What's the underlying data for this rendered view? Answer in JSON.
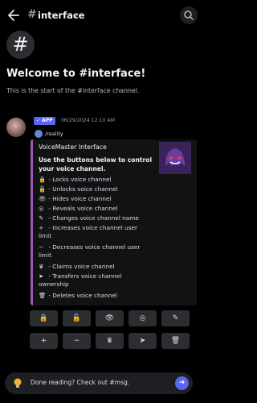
{
  "topbar": {
    "hash": "#",
    "channel_name": "interface",
    "chevron": "›"
  },
  "intro": {
    "hash": "#",
    "welcome": "Welcome to #interface!",
    "start_text": "This is the start of the #interface channel."
  },
  "message": {
    "badge": "✓ APP",
    "timestamp": "06/29/2024 12:10 AM",
    "reply_name": "/reality"
  },
  "embed": {
    "title": "VoiceMaster Interface",
    "heading": "Use the buttons below to control your voice channel.",
    "accent_color": "#9b59b6",
    "features": [
      {
        "icon": "lock-icon",
        "glyph": "🔒",
        "text": "- Locks voice channel",
        "cont": ""
      },
      {
        "icon": "unlock-icon",
        "glyph": "🔓",
        "text": "- Unlocks voice channel",
        "cont": ""
      },
      {
        "icon": "eye-icon",
        "glyph": "👁",
        "text": "- Hides voice channel",
        "cont": ""
      },
      {
        "icon": "eye-off-icon",
        "glyph": "◎",
        "text": "- Reveals voice channel",
        "cont": ""
      },
      {
        "icon": "pencil-icon",
        "glyph": "✎",
        "text": "- Changes voice channel name",
        "cont": ""
      },
      {
        "icon": "user-plus-icon",
        "glyph": "+",
        "text": "- Increases voice channel user",
        "cont": "limit"
      },
      {
        "icon": "user-minus-icon",
        "glyph": "−",
        "text": "- Decreases voice channel user",
        "cont": "limit"
      },
      {
        "icon": "crown-icon",
        "glyph": "♛",
        "text": "- Claims voice channel",
        "cont": ""
      },
      {
        "icon": "send-icon",
        "glyph": "➤",
        "text": "- Transfers voice channel",
        "cont": "ownership"
      },
      {
        "icon": "trash-icon",
        "glyph": "🗑",
        "text": "- Deletes voice channel",
        "cont": ""
      }
    ]
  },
  "buttons": [
    {
      "name": "lock",
      "glyph": "🔒"
    },
    {
      "name": "unlock",
      "glyph": "🔓"
    },
    {
      "name": "hide",
      "glyph": "👁"
    },
    {
      "name": "reveal",
      "glyph": "◎"
    },
    {
      "name": "rename",
      "glyph": "✎"
    },
    {
      "name": "increase",
      "glyph": "+"
    },
    {
      "name": "decrease",
      "glyph": "−"
    },
    {
      "name": "claim",
      "glyph": "♛"
    },
    {
      "name": "transfer",
      "glyph": "➤"
    },
    {
      "name": "delete",
      "glyph": "🗑"
    }
  ],
  "input": {
    "tip_text": "Done reading? Check out #msg.",
    "send_glyph": "➜"
  }
}
